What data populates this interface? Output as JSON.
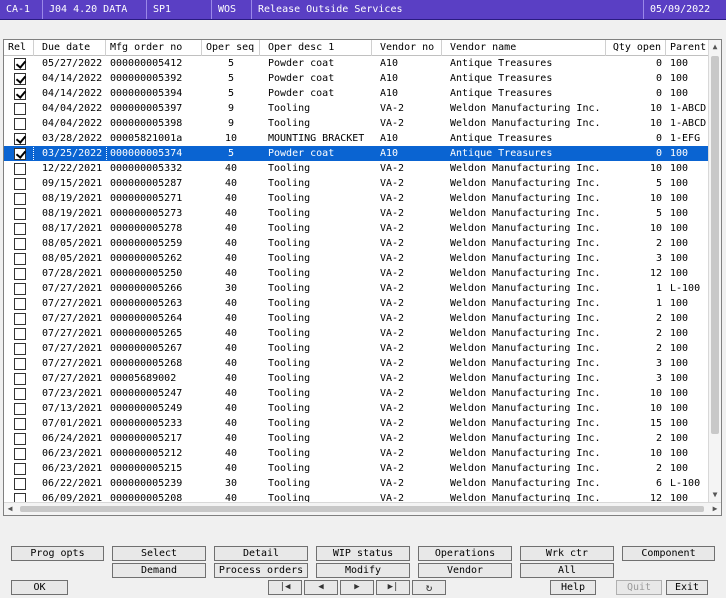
{
  "titlebar": {
    "segments": [
      "CA-1",
      "J04 4.20 DATA",
      "SP1",
      "WOS",
      "Release Outside Services",
      "05/09/2022"
    ]
  },
  "grid": {
    "columns": [
      "Rel",
      "Due date",
      "Mfg order no",
      "Oper seq",
      "Oper desc 1",
      "Vendor no",
      "Vendor name",
      "Qty open",
      "Parent"
    ],
    "rows": [
      {
        "rel": true,
        "due": "05/27/2022",
        "mfg": "000000005412",
        "seq": "5",
        "desc": "Powder coat",
        "vendor": "A10",
        "vname": "Antique Treasures",
        "qty": "0",
        "parent": "100"
      },
      {
        "rel": true,
        "due": "04/14/2022",
        "mfg": "000000005392",
        "seq": "5",
        "desc": "Powder coat",
        "vendor": "A10",
        "vname": "Antique Treasures",
        "qty": "0",
        "parent": "100"
      },
      {
        "rel": true,
        "due": "04/14/2022",
        "mfg": "000000005394",
        "seq": "5",
        "desc": "Powder coat",
        "vendor": "A10",
        "vname": "Antique Treasures",
        "qty": "0",
        "parent": "100"
      },
      {
        "rel": false,
        "due": "04/04/2022",
        "mfg": "000000005397",
        "seq": "9",
        "desc": "Tooling",
        "vendor": "VA-2",
        "vname": "Weldon Manufacturing Inc.",
        "qty": "10",
        "parent": "1-ABCD"
      },
      {
        "rel": false,
        "due": "04/04/2022",
        "mfg": "000000005398",
        "seq": "9",
        "desc": "Tooling",
        "vendor": "VA-2",
        "vname": "Weldon Manufacturing Inc.",
        "qty": "10",
        "parent": "1-ABCD"
      },
      {
        "rel": true,
        "due": "03/28/2022",
        "mfg": "00005821001a",
        "seq": "10",
        "desc": "MOUNTING BRACKET",
        "vendor": "A10",
        "vname": "Antique Treasures",
        "qty": "0",
        "parent": "1-EFG"
      },
      {
        "rel": true,
        "due": "03/25/2022",
        "mfg": "000000005374",
        "seq": "5",
        "desc": "Powder coat",
        "vendor": "A10",
        "vname": "Antique Treasures",
        "qty": "0",
        "parent": "100",
        "selected": true
      },
      {
        "rel": false,
        "due": "12/22/2021",
        "mfg": "000000005332",
        "seq": "40",
        "desc": "Tooling",
        "vendor": "VA-2",
        "vname": "Weldon Manufacturing Inc.",
        "qty": "10",
        "parent": "100"
      },
      {
        "rel": false,
        "due": "09/15/2021",
        "mfg": "000000005287",
        "seq": "40",
        "desc": "Tooling",
        "vendor": "VA-2",
        "vname": "Weldon Manufacturing Inc.",
        "qty": "5",
        "parent": "100"
      },
      {
        "rel": false,
        "due": "08/19/2021",
        "mfg": "000000005271",
        "seq": "40",
        "desc": "Tooling",
        "vendor": "VA-2",
        "vname": "Weldon Manufacturing Inc.",
        "qty": "10",
        "parent": "100"
      },
      {
        "rel": false,
        "due": "08/19/2021",
        "mfg": "000000005273",
        "seq": "40",
        "desc": "Tooling",
        "vendor": "VA-2",
        "vname": "Weldon Manufacturing Inc.",
        "qty": "5",
        "parent": "100"
      },
      {
        "rel": false,
        "due": "08/17/2021",
        "mfg": "000000005278",
        "seq": "40",
        "desc": "Tooling",
        "vendor": "VA-2",
        "vname": "Weldon Manufacturing Inc.",
        "qty": "10",
        "parent": "100"
      },
      {
        "rel": false,
        "due": "08/05/2021",
        "mfg": "000000005259",
        "seq": "40",
        "desc": "Tooling",
        "vendor": "VA-2",
        "vname": "Weldon Manufacturing Inc.",
        "qty": "2",
        "parent": "100"
      },
      {
        "rel": false,
        "due": "08/05/2021",
        "mfg": "000000005262",
        "seq": "40",
        "desc": "Tooling",
        "vendor": "VA-2",
        "vname": "Weldon Manufacturing Inc.",
        "qty": "3",
        "parent": "100"
      },
      {
        "rel": false,
        "due": "07/28/2021",
        "mfg": "000000005250",
        "seq": "40",
        "desc": "Tooling",
        "vendor": "VA-2",
        "vname": "Weldon Manufacturing Inc.",
        "qty": "12",
        "parent": "100"
      },
      {
        "rel": false,
        "due": "07/27/2021",
        "mfg": "000000005266",
        "seq": "30",
        "desc": "Tooling",
        "vendor": "VA-2",
        "vname": "Weldon Manufacturing Inc.",
        "qty": "1",
        "parent": "L-100"
      },
      {
        "rel": false,
        "due": "07/27/2021",
        "mfg": "000000005263",
        "seq": "40",
        "desc": "Tooling",
        "vendor": "VA-2",
        "vname": "Weldon Manufacturing Inc.",
        "qty": "1",
        "parent": "100"
      },
      {
        "rel": false,
        "due": "07/27/2021",
        "mfg": "000000005264",
        "seq": "40",
        "desc": "Tooling",
        "vendor": "VA-2",
        "vname": "Weldon Manufacturing Inc.",
        "qty": "2",
        "parent": "100"
      },
      {
        "rel": false,
        "due": "07/27/2021",
        "mfg": "000000005265",
        "seq": "40",
        "desc": "Tooling",
        "vendor": "VA-2",
        "vname": "Weldon Manufacturing Inc.",
        "qty": "2",
        "parent": "100"
      },
      {
        "rel": false,
        "due": "07/27/2021",
        "mfg": "000000005267",
        "seq": "40",
        "desc": "Tooling",
        "vendor": "VA-2",
        "vname": "Weldon Manufacturing Inc.",
        "qty": "2",
        "parent": "100"
      },
      {
        "rel": false,
        "due": "07/27/2021",
        "mfg": "000000005268",
        "seq": "40",
        "desc": "Tooling",
        "vendor": "VA-2",
        "vname": "Weldon Manufacturing Inc.",
        "qty": "3",
        "parent": "100"
      },
      {
        "rel": false,
        "due": "07/27/2021",
        "mfg": "00005689002",
        "seq": "40",
        "desc": "Tooling",
        "vendor": "VA-2",
        "vname": "Weldon Manufacturing Inc.",
        "qty": "3",
        "parent": "100"
      },
      {
        "rel": false,
        "due": "07/23/2021",
        "mfg": "000000005247",
        "seq": "40",
        "desc": "Tooling",
        "vendor": "VA-2",
        "vname": "Weldon Manufacturing Inc.",
        "qty": "10",
        "parent": "100"
      },
      {
        "rel": false,
        "due": "07/13/2021",
        "mfg": "000000005249",
        "seq": "40",
        "desc": "Tooling",
        "vendor": "VA-2",
        "vname": "Weldon Manufacturing Inc.",
        "qty": "10",
        "parent": "100"
      },
      {
        "rel": false,
        "due": "07/01/2021",
        "mfg": "000000005233",
        "seq": "40",
        "desc": "Tooling",
        "vendor": "VA-2",
        "vname": "Weldon Manufacturing Inc.",
        "qty": "15",
        "parent": "100"
      },
      {
        "rel": false,
        "due": "06/24/2021",
        "mfg": "000000005217",
        "seq": "40",
        "desc": "Tooling",
        "vendor": "VA-2",
        "vname": "Weldon Manufacturing Inc.",
        "qty": "2",
        "parent": "100"
      },
      {
        "rel": false,
        "due": "06/23/2021",
        "mfg": "000000005212",
        "seq": "40",
        "desc": "Tooling",
        "vendor": "VA-2",
        "vname": "Weldon Manufacturing Inc.",
        "qty": "10",
        "parent": "100"
      },
      {
        "rel": false,
        "due": "06/23/2021",
        "mfg": "000000005215",
        "seq": "40",
        "desc": "Tooling",
        "vendor": "VA-2",
        "vname": "Weldon Manufacturing Inc.",
        "qty": "2",
        "parent": "100"
      },
      {
        "rel": false,
        "due": "06/22/2021",
        "mfg": "000000005239",
        "seq": "30",
        "desc": "Tooling",
        "vendor": "VA-2",
        "vname": "Weldon Manufacturing Inc.",
        "qty": "6",
        "parent": "L-100"
      },
      {
        "rel": false,
        "due": "06/09/2021",
        "mfg": "000000005208",
        "seq": "40",
        "desc": "Tooling",
        "vendor": "VA-2",
        "vname": "Weldon Manufacturing Inc.",
        "qty": "12",
        "parent": "100"
      }
    ]
  },
  "buttons": {
    "prog_opts": "Prog opts",
    "select": "Select",
    "detail": "Detail",
    "wip_status": "WIP status",
    "operations": "Operations",
    "wrk_ctr": "Wrk ctr",
    "component": "Component",
    "demand": "Demand",
    "process_orders": "Process orders",
    "modify": "Modify",
    "vendor": "Vendor",
    "all": "All",
    "ok": "OK",
    "help": "Help",
    "quit": "Quit",
    "exit": "Exit"
  },
  "nav": {
    "first": "|◀",
    "prev": "◀",
    "next": "▶",
    "last": "▶|",
    "refresh": "↻"
  },
  "colors": {
    "titlebar": "#5a3fc4",
    "selection": "#0a64d2"
  }
}
